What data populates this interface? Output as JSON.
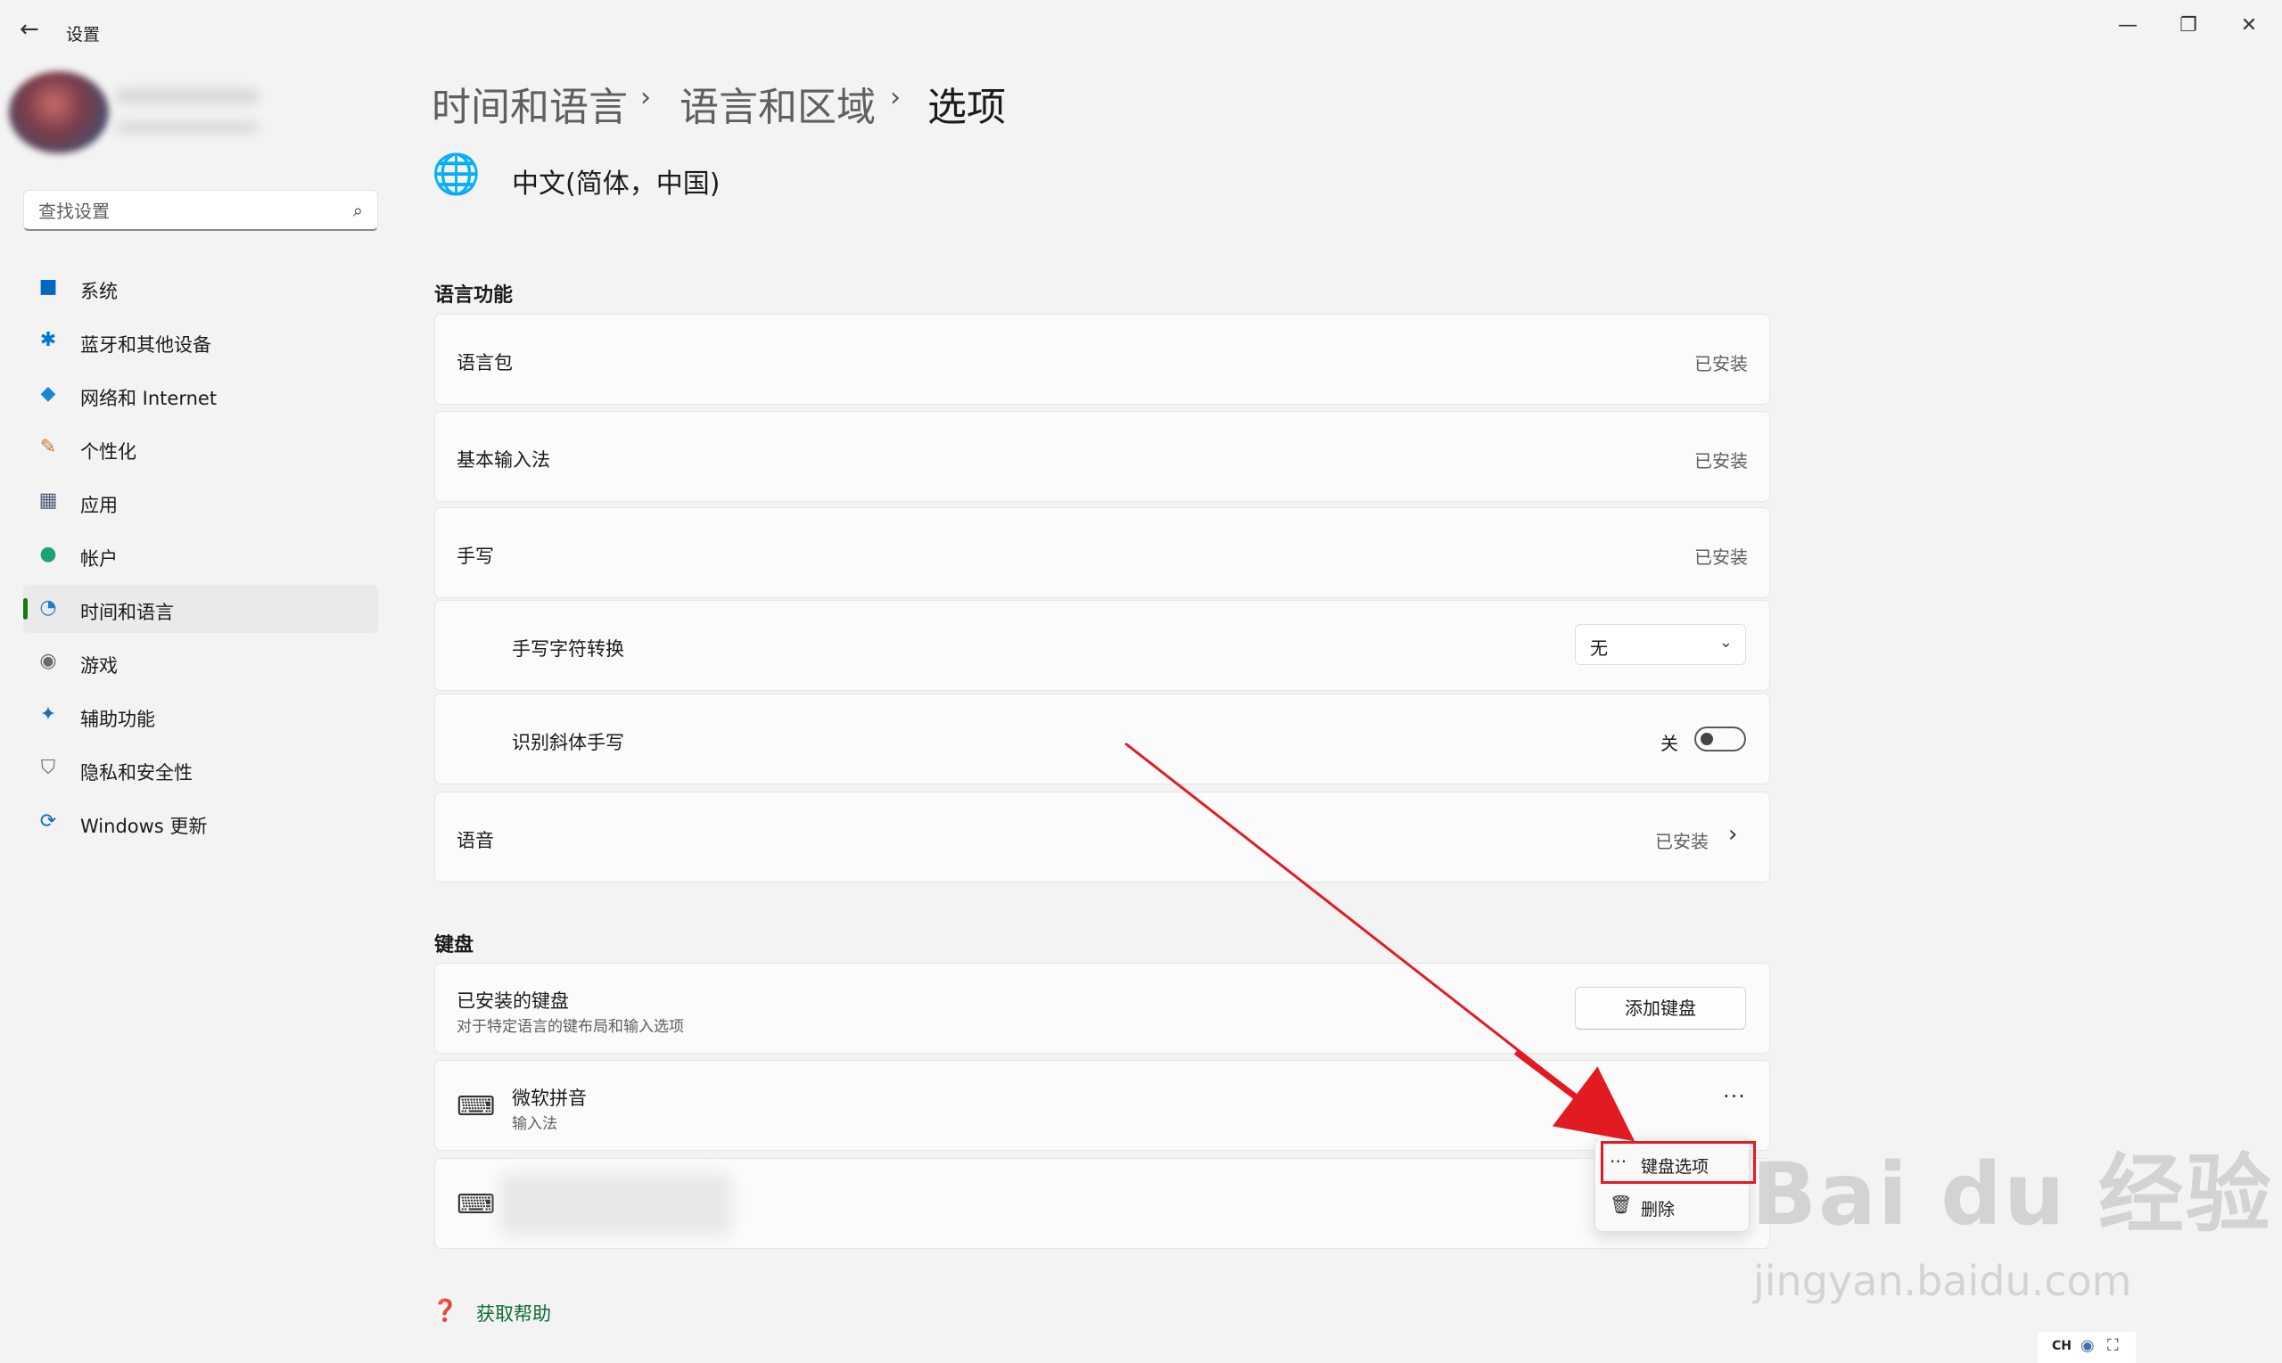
{
  "window": {
    "title": "设置",
    "back_glyph": "←",
    "minimize": "—",
    "restore": "❐",
    "close": "✕"
  },
  "search": {
    "placeholder": "查找设置",
    "icon": "⌕"
  },
  "nav": [
    {
      "label": "系统",
      "icon": "■",
      "color": "#0067c0"
    },
    {
      "label": "蓝牙和其他设备",
      "icon": "✱",
      "color": "#0078d4"
    },
    {
      "label": "网络和 Internet",
      "icon": "◆",
      "color": "#1a86d9"
    },
    {
      "label": "个性化",
      "icon": "✎",
      "color": "#c47a2c"
    },
    {
      "label": "应用",
      "icon": "▦",
      "color": "#4a5d7a"
    },
    {
      "label": "帐户",
      "icon": "●",
      "color": "#1aa37a"
    },
    {
      "label": "时间和语言",
      "icon": "◔",
      "color": "#1e7fc8",
      "active": true
    },
    {
      "label": "游戏",
      "icon": "◉",
      "color": "#6a6a6a"
    },
    {
      "label": "辅助功能",
      "icon": "✦",
      "color": "#1a6fb8"
    },
    {
      "label": "隐私和安全性",
      "icon": "⛉",
      "color": "#6a6a6a"
    },
    {
      "label": "Windows 更新",
      "icon": "⟳",
      "color": "#0f6cbd"
    }
  ],
  "breadcrumb": {
    "part1": "时间和语言",
    "part2": "语言和区域",
    "part3": "选项",
    "sep": "›"
  },
  "language": {
    "icon": "🌐",
    "title": "中文(简体，中国)"
  },
  "lang_features": {
    "heading": "语言功能",
    "pack": {
      "label": "语言包",
      "status": "已安装"
    },
    "ime": {
      "label": "基本输入法",
      "status": "已安装"
    },
    "handwriting": {
      "label": "手写",
      "status": "已安装"
    },
    "hw_convert": {
      "label": "手写字符转换",
      "value": "无",
      "chevron": "⌄"
    },
    "hw_italic": {
      "label": "识别斜体手写",
      "state": "关"
    },
    "speech": {
      "label": "语音",
      "status": "已安装",
      "chevron": "›"
    }
  },
  "keyboard": {
    "heading": "键盘",
    "installed": {
      "title": "已安装的键盘",
      "subtitle": "对于特定语言的键布局和输入选项",
      "add_button": "添加键盘"
    },
    "pinyin": {
      "name": "微软拼音",
      "type": "输入法",
      "more": "···",
      "icon": "⌨"
    },
    "other": {
      "icon": "⌨"
    }
  },
  "context_menu": {
    "options": {
      "icon": "···",
      "label": "键盘选项"
    },
    "delete": {
      "icon": "🗑",
      "label": "删除"
    }
  },
  "help": {
    "icon": "❓",
    "label": "获取帮助"
  },
  "watermark": {
    "brand": "Bai du 经验",
    "url": "jingyan.baidu.com"
  },
  "tray": {
    "text": "CH",
    "icon1": "◉",
    "icon2": "⛶"
  },
  "accent": {
    "green": "#107c10",
    "annotation_red": "#e21b23"
  }
}
